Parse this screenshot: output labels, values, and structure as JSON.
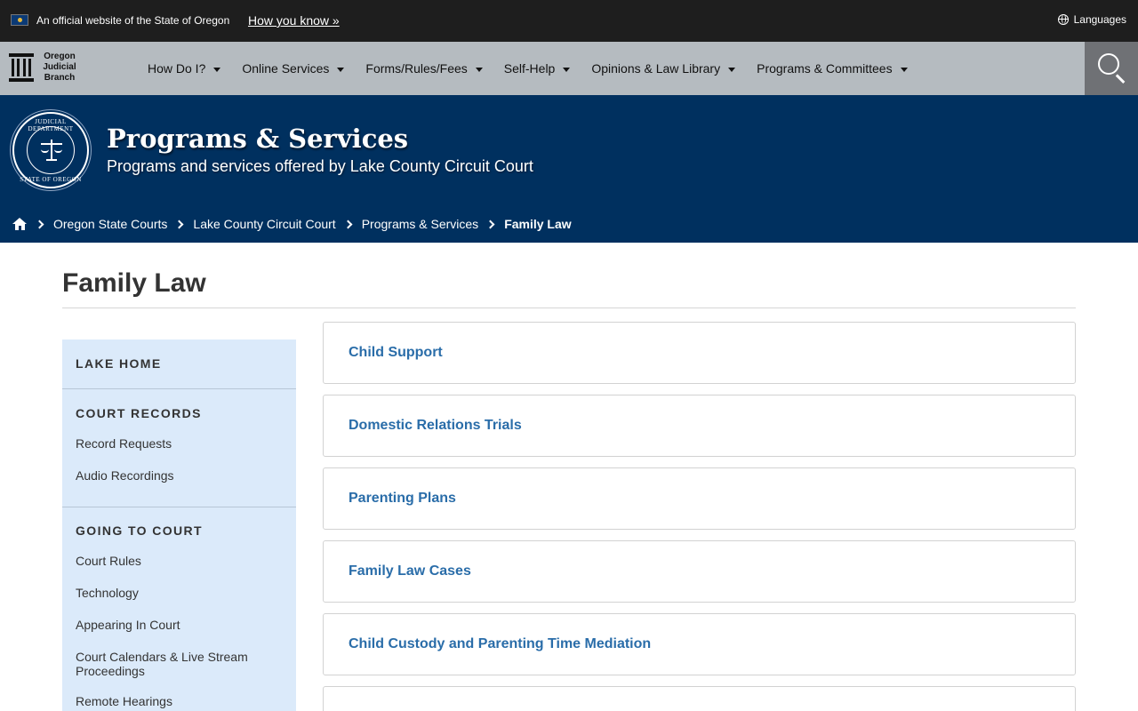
{
  "official_banner": {
    "text": "An official website of the State of Oregon",
    "link_label": "How you know »",
    "languages_label": "Languages"
  },
  "logo": {
    "text": "Oregon Judicial Branch"
  },
  "nav": {
    "items": [
      {
        "label": "How Do I?"
      },
      {
        "label": "Online Services"
      },
      {
        "label": "Forms/Rules/Fees"
      },
      {
        "label": "Self-Help"
      },
      {
        "label": "Opinions & Law Library"
      },
      {
        "label": "Programs & Committees"
      }
    ],
    "search_icon": "search-icon"
  },
  "hero": {
    "title": "Programs & Services",
    "subtitle": "Programs and services offered by Lake County Circuit Court",
    "seal_top": "JUDICIAL DEPARTMENT",
    "seal_bottom": "STATE OF OREGON"
  },
  "breadcrumb": {
    "items": [
      "Oregon State Courts",
      "Lake County Circuit Court",
      "Programs & Services"
    ],
    "current": "Family Law"
  },
  "page": {
    "title": "Family Law"
  },
  "sidebar": {
    "sections": [
      {
        "heading": "LAKE HOME",
        "links": []
      },
      {
        "heading": "COURT RECORDS",
        "links": [
          "Record Requests",
          "Audio Recordings"
        ]
      },
      {
        "heading": "GOING TO COURT",
        "links": [
          "Court Rules",
          "Technology",
          "Appearing In Court",
          "Court Calendars & Live Stream Proceedings",
          "Remote Hearings"
        ]
      }
    ]
  },
  "cards": [
    {
      "label": "Child Support"
    },
    {
      "label": "Domestic Relations Trials"
    },
    {
      "label": "Parenting Plans"
    },
    {
      "label": "Family Law Cases"
    },
    {
      "label": "Child Custody and Parenting Time Mediation"
    },
    {
      "label": ""
    }
  ],
  "colors": {
    "banner_bg": "#1e1e1e",
    "nav_bg": "#b5bbc0",
    "hero_bg": "#00305f",
    "sidebar_bg": "#dbeafa",
    "link": "#2a6da9"
  }
}
